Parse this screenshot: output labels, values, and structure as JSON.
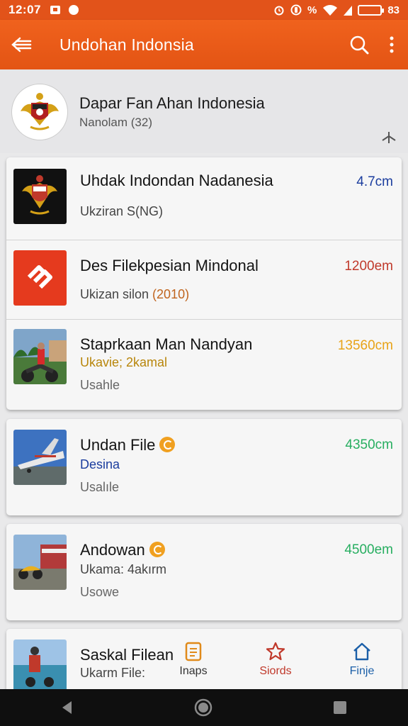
{
  "status_bar": {
    "time": "12:07",
    "battery": "83"
  },
  "app_bar": {
    "title": "Undohan Indonsia"
  },
  "header": {
    "title": "Dapar Fan Ahan Indonesia",
    "subtitle": "Nanolam (32)"
  },
  "list": [
    {
      "title": "Uhdak Indondan Nadanesia",
      "subtitle": "Ukziran S(NG)",
      "value": "4.7cm",
      "value_color": "#1b3d9e"
    },
    {
      "title": "Des Filekpesian Mindonal",
      "subtitle_prefix": "Ukizan silon ",
      "subtitle_highlight": "(2010)",
      "value": "1200em",
      "value_color": "#c0392b"
    },
    {
      "title": "Staprkaan Man Nandyan",
      "subtitle": "Ukavie; 2kamal",
      "meta": "Usahle",
      "value": "13560cm",
      "value_color": "#e8a317"
    },
    {
      "title": "Undan File",
      "subtitle": "Desina",
      "meta": "Usalıle",
      "value": "4350cm",
      "value_color": "#27ae60"
    },
    {
      "title": "Andowan",
      "subtitle": "Ukama: 4akırm",
      "meta": "Usowe",
      "value": "4500em",
      "value_color": "#27ae60"
    },
    {
      "title": "Saskal Filean",
      "subtitle": "Ukarm File:"
    }
  ],
  "bottom_nav": [
    {
      "label": "Inaps",
      "icon": "document-icon",
      "color": "#333333"
    },
    {
      "label": "Siords",
      "icon": "star-icon",
      "color": "#c0392b"
    },
    {
      "label": "Finje",
      "icon": "home-icon",
      "color": "#1b5fa8"
    }
  ]
}
